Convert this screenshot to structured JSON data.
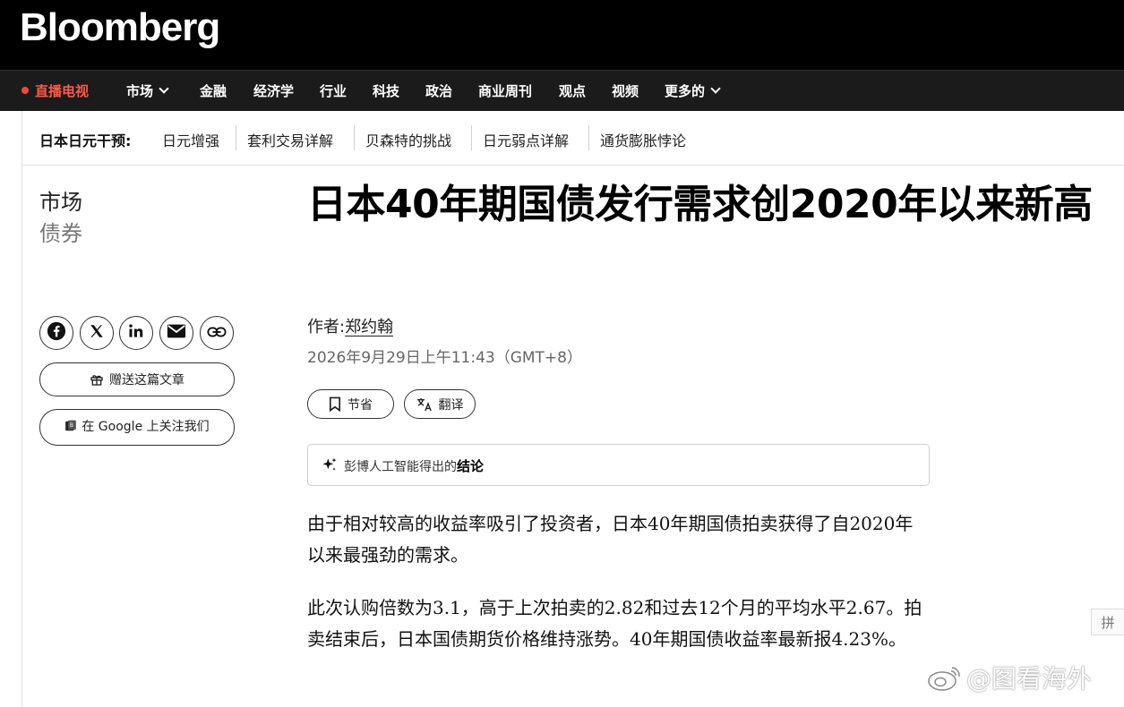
{
  "header": {
    "logo": "Bloomberg"
  },
  "nav": {
    "live": "直播电视",
    "items": [
      "市场",
      "金融",
      "经济学",
      "行业",
      "科技",
      "政治",
      "商业周刊",
      "观点",
      "视频",
      "更多的"
    ]
  },
  "topics": {
    "label": "日本日元干预:",
    "links": [
      "日元增强",
      "套利交易详解",
      "贝森特的挑战",
      "日元弱点详解",
      "通货膨胀悖论"
    ]
  },
  "section": {
    "main": "市场",
    "sub": "债券"
  },
  "share": {
    "icons": [
      "facebook-icon",
      "x-icon",
      "linkedin-icon",
      "email-icon",
      "link-icon"
    ],
    "gift_label": "赠送这篇文章",
    "google_label": "在 Google 上关注我们"
  },
  "article": {
    "headline": "日本40年期国债发行需求创2020年以来新高",
    "byline_prefix": "作者:",
    "author": "郑约翰",
    "date": "2026年9月29日上午11:43（GMT+8）",
    "save_label": "节省",
    "translate_label": "翻译",
    "ai_prefix": "彭博人工智能得出的",
    "ai_bold": "结论",
    "paragraphs": [
      "由于相对较高的收益率吸引了投资者，日本40年期国债拍卖获得了自2020年以来最强劲的需求。",
      "此次认购倍数为3.1，高于上次拍卖的2.82和过去12个月的平均水平2.67。拍卖结束后，日本国债期货价格维持涨势。40年期国债收益率最新报4.23%。"
    ]
  },
  "side_tab": "拼",
  "watermark": "@图看海外",
  "colors": {
    "live": "#ff5a48",
    "topbar": "#000000",
    "navbar": "#1b1b1b"
  }
}
